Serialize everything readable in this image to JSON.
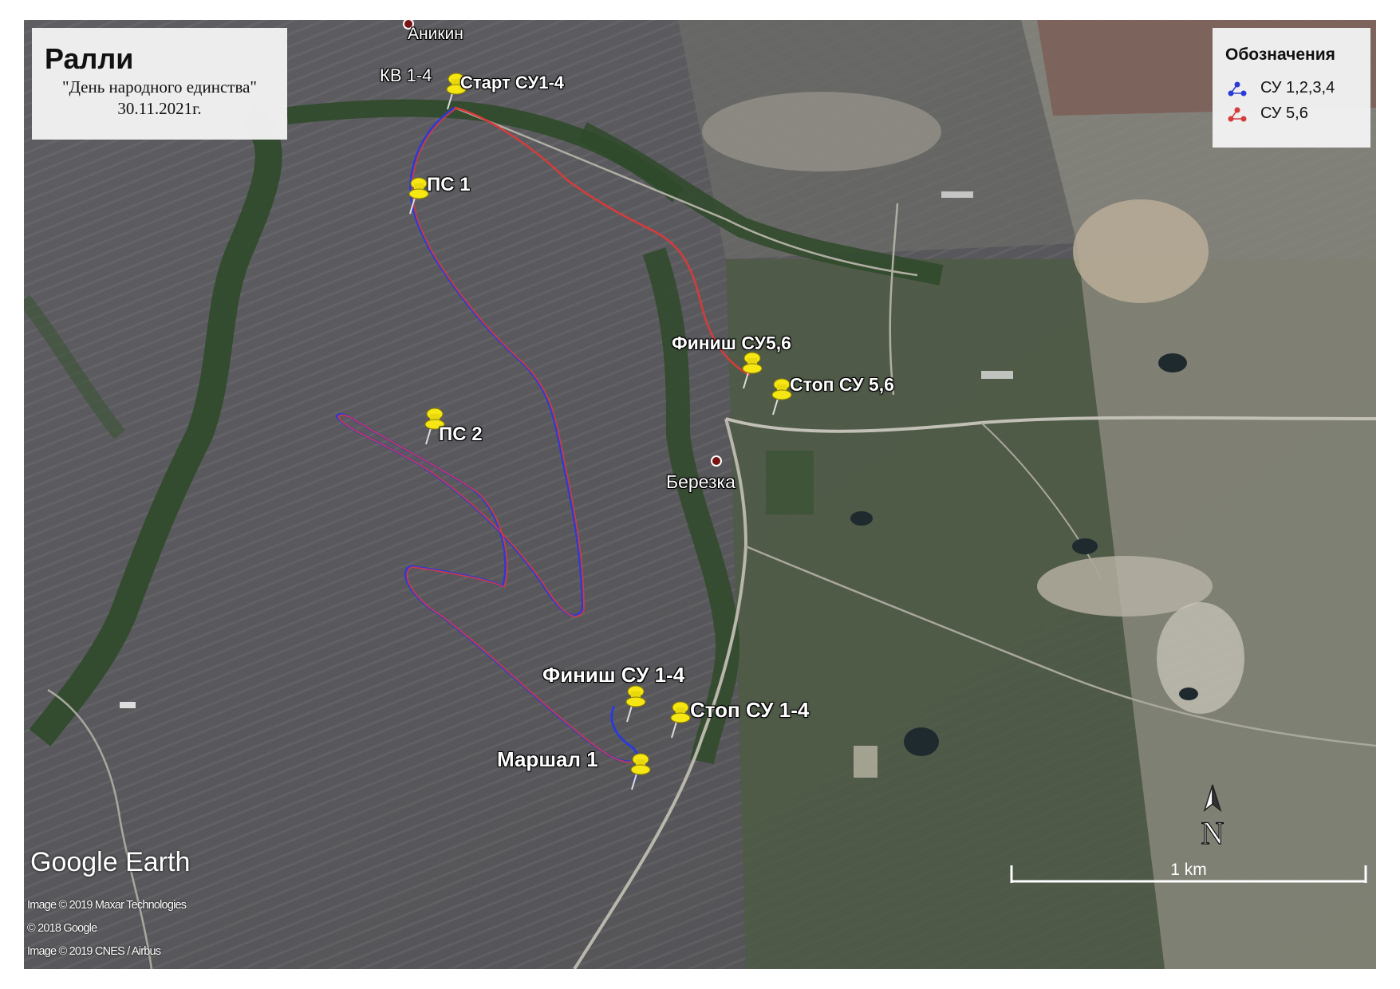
{
  "title": {
    "main": "Ралли",
    "subtitle": "\"День народного единства\"",
    "date": "30.11.2021г."
  },
  "legend": {
    "heading": "Обозначения",
    "items": [
      {
        "label": "СУ 1,2,3,4",
        "color": "#2b3bd6",
        "icon": "route-blue-icon"
      },
      {
        "label": "СУ 5,6",
        "color": "#d63b3b",
        "icon": "route-red-icon"
      }
    ]
  },
  "places": {
    "anikin": "Аникин",
    "berezka": "Березка"
  },
  "markers": [
    {
      "id": "kv14",
      "label": "КВ 1-4"
    },
    {
      "id": "start14",
      "label": "Старт СУ1-4"
    },
    {
      "id": "ps1",
      "label": "ПС 1"
    },
    {
      "id": "ps2",
      "label": "ПС 2"
    },
    {
      "id": "finish56",
      "label": "Финиш СУ5,6"
    },
    {
      "id": "stop56",
      "label": "Стоп СУ 5,6"
    },
    {
      "id": "finish14",
      "label": "Финиш СУ 1-4"
    },
    {
      "id": "stop14",
      "label": "Стоп СУ 1-4"
    },
    {
      "id": "marshal1",
      "label": "Маршал 1"
    }
  ],
  "branding": {
    "logo": "Google Earth",
    "credits": [
      "Image © 2019 Maxar Technologies",
      "© 2018 Google",
      "Image © 2019 CNES / Airbus"
    ]
  },
  "north_label": "N",
  "scale_label": "1 km",
  "colors": {
    "route_blue": "#2b3bd6",
    "route_red": "#d63b3b",
    "pin_yellow": "#f5e614",
    "terrain": "#5a5a5c"
  }
}
